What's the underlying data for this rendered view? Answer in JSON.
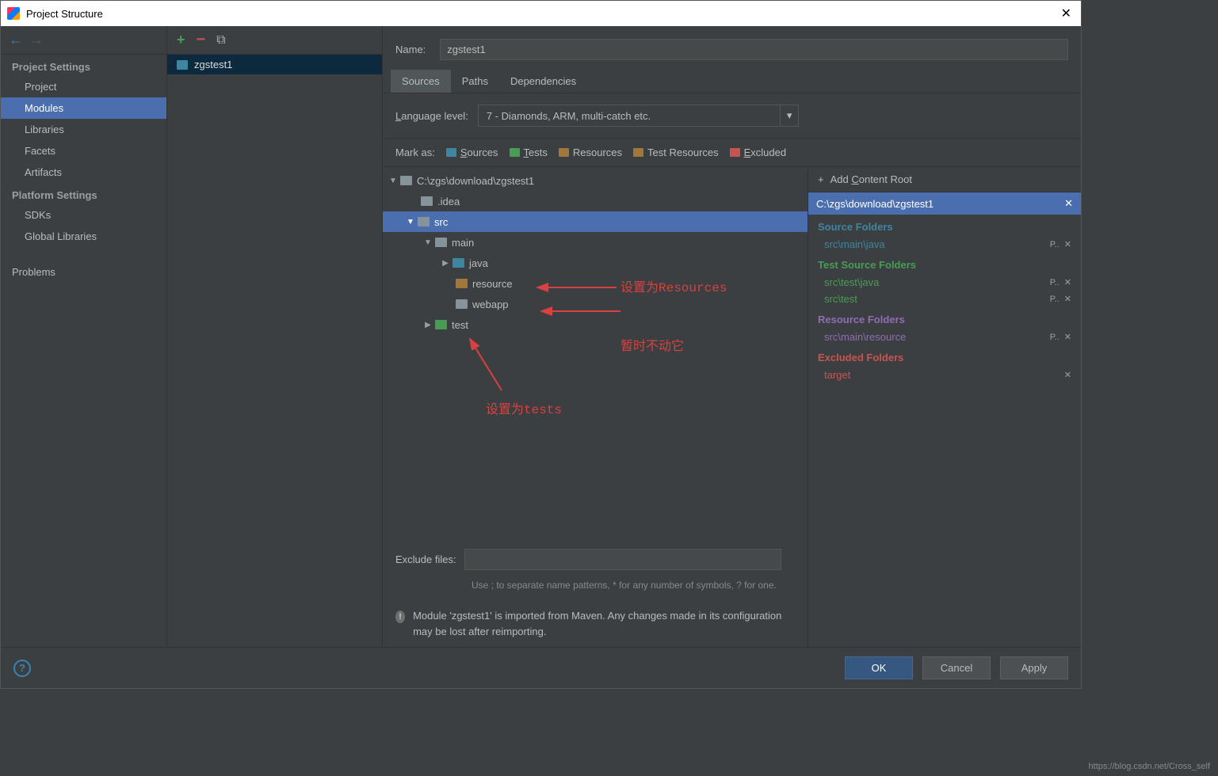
{
  "window": {
    "title": "Project Structure"
  },
  "sidebar": {
    "sections": [
      {
        "title": "Project Settings",
        "items": [
          "Project",
          "Modules",
          "Libraries",
          "Facets",
          "Artifacts"
        ],
        "selected": 1
      },
      {
        "title": "Platform Settings",
        "items": [
          "SDKs",
          "Global Libraries"
        ]
      }
    ],
    "problems": "Problems"
  },
  "module_list": {
    "items": [
      "zgstest1"
    ]
  },
  "detail": {
    "name_label": "Name:",
    "name_value": "zgstest1",
    "tabs": [
      "Sources",
      "Paths",
      "Dependencies"
    ],
    "active_tab": 0,
    "lang_label": "Language level:",
    "lang_value": "7 - Diamonds, ARM, multi-catch etc.",
    "mark_label": "Mark as:",
    "mark_chips": {
      "sources": "Sources",
      "tests": "Tests",
      "resources": "Resources",
      "testres": "Test Resources",
      "excluded": "Excluded"
    },
    "tree": {
      "root": "C:\\zgs\\download\\zgstest1",
      "idea": ".idea",
      "src": "src",
      "main": "main",
      "java": "java",
      "resource": "resource",
      "webapp": "webapp",
      "test": "test"
    },
    "exclude_label": "Exclude files:",
    "exclude_hint": "Use ; to separate name patterns, * for any number of symbols, ? for one.",
    "warn": "Module 'zgstest1' is imported from Maven. Any changes made in its configuration may be lost after reimporting."
  },
  "content_root": {
    "add_label": "Add Content Root",
    "path": "C:\\zgs\\download\\zgstest1",
    "sections": {
      "source": {
        "title": "Source Folders",
        "items": [
          "src\\main\\java"
        ]
      },
      "test": {
        "title": "Test Source Folders",
        "items": [
          "src\\test\\java",
          "src\\test"
        ]
      },
      "resource": {
        "title": "Resource Folders",
        "items": [
          "src\\main\\resource"
        ]
      },
      "excluded": {
        "title": "Excluded Folders",
        "items": [
          "target"
        ]
      }
    }
  },
  "annotations": {
    "a1": "设置为Resources",
    "a2": "暂时不动它",
    "a3": "设置为tests"
  },
  "footer": {
    "ok": "OK",
    "cancel": "Cancel",
    "apply": "Apply"
  },
  "watermark": "https://blog.csdn.net/Cross_self"
}
